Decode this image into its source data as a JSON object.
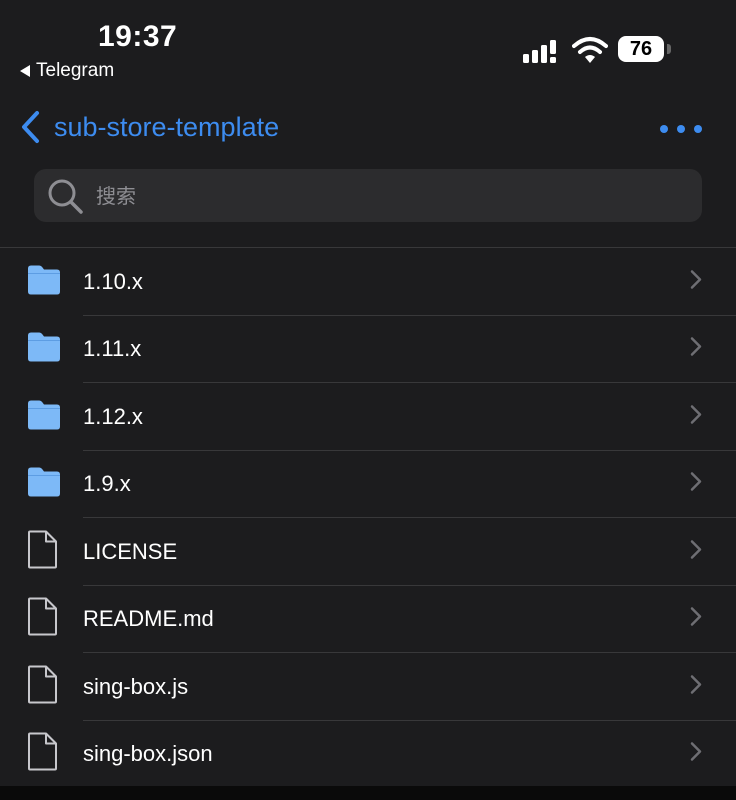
{
  "status_bar": {
    "time": "19:37",
    "back_app": "Telegram",
    "battery": "76"
  },
  "nav": {
    "title": "sub-store-template"
  },
  "search": {
    "placeholder": "搜索"
  },
  "colors": {
    "accent": "#3d8cf0",
    "folder": "#7db9f7",
    "background": "#1c1c1e"
  },
  "items": [
    {
      "name": "1.10.x",
      "type": "folder"
    },
    {
      "name": "1.11.x",
      "type": "folder"
    },
    {
      "name": "1.12.x",
      "type": "folder"
    },
    {
      "name": "1.9.x",
      "type": "folder"
    },
    {
      "name": "LICENSE",
      "type": "file"
    },
    {
      "name": "README.md",
      "type": "file"
    },
    {
      "name": "sing-box.js",
      "type": "file"
    },
    {
      "name": "sing-box.json",
      "type": "file"
    }
  ]
}
